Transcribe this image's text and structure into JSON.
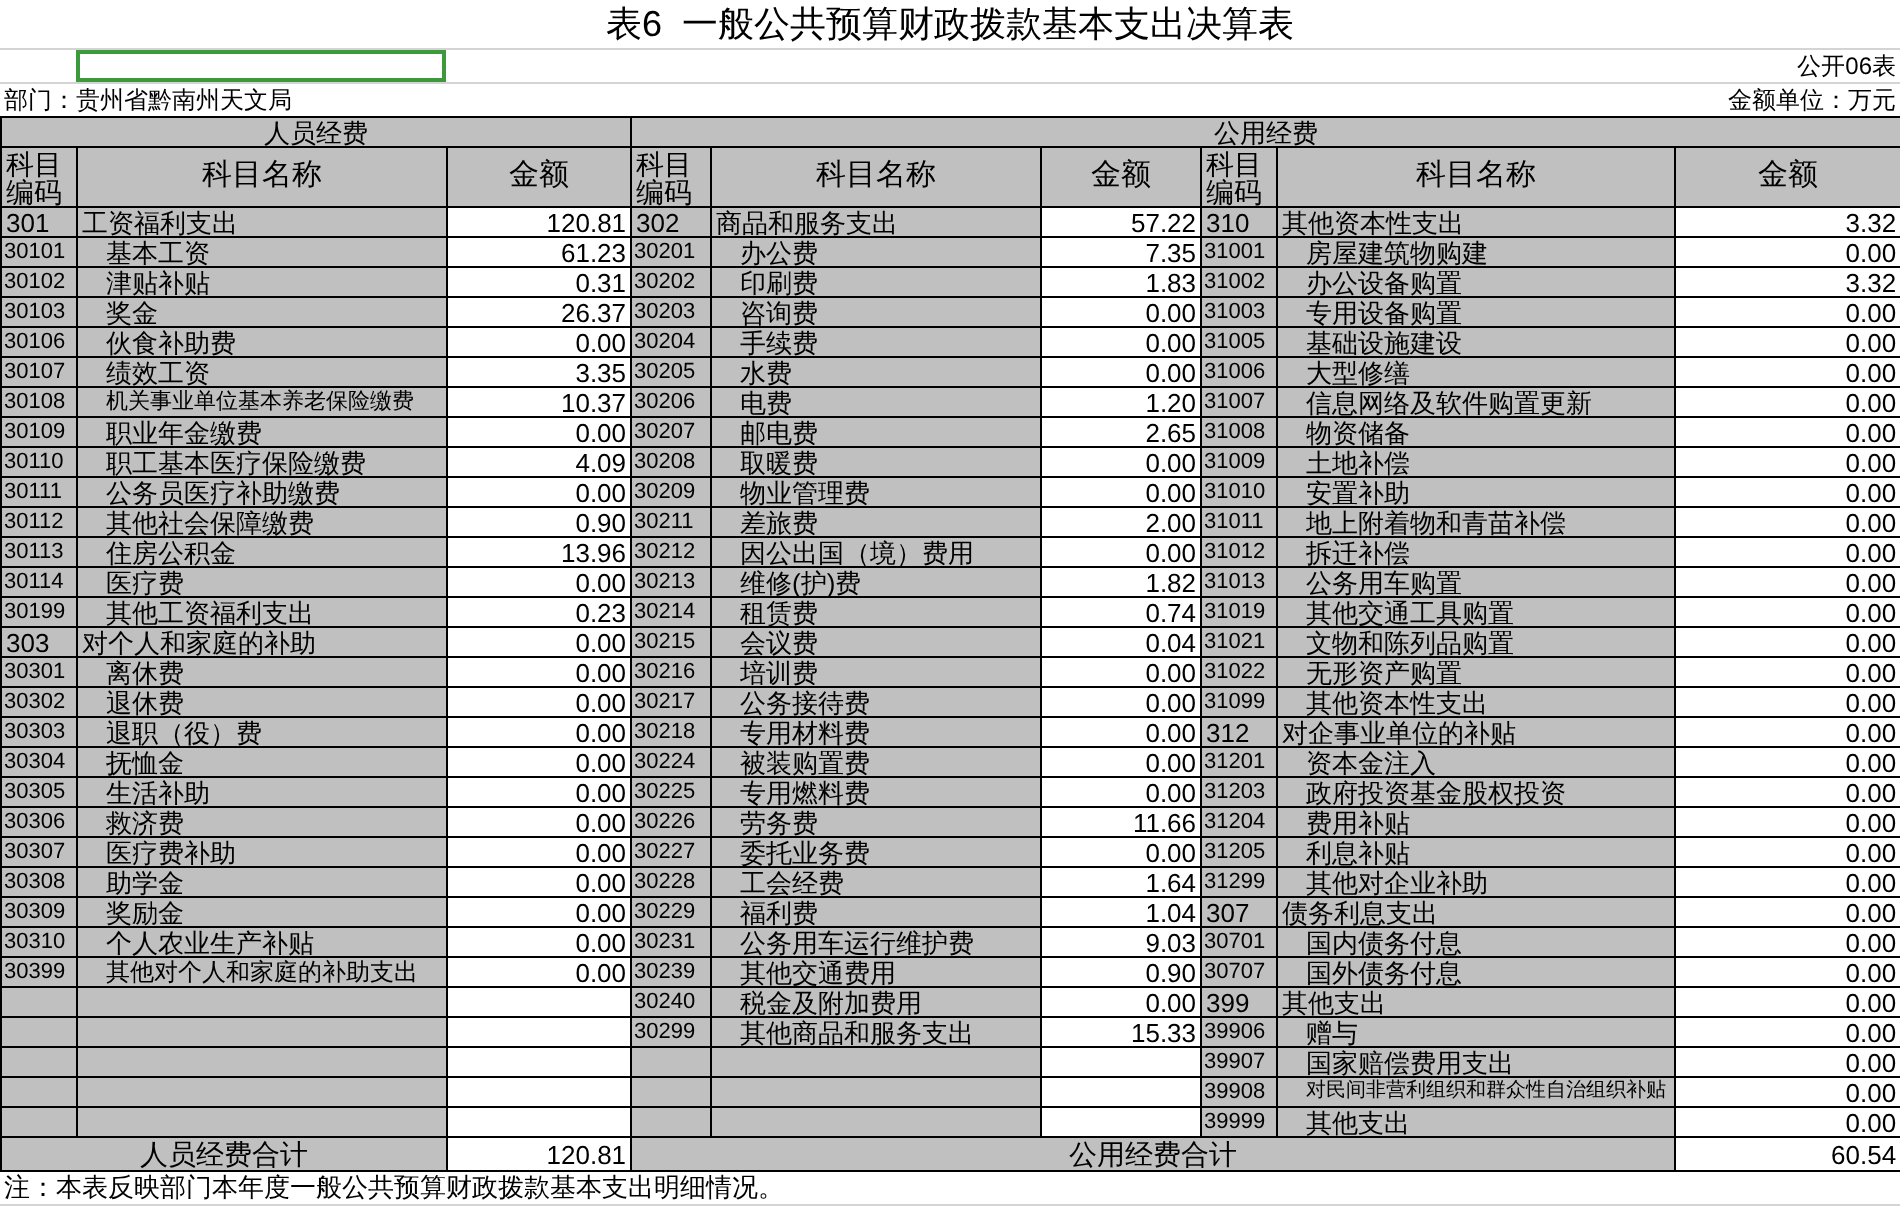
{
  "title": "表6  一般公共预算财政拨款基本支出决算表",
  "form_no": "公开06表",
  "department": "部门：贵州省黔南州天文局",
  "unit": "金额单位：万元",
  "sections": [
    {
      "title": "人员经费",
      "columns": [
        "科目编码",
        "科目名称",
        "金额"
      ],
      "rows": [
        {
          "kind": "category",
          "code": "301",
          "name": "工资福利支出",
          "amount": "120.81"
        },
        {
          "kind": "item",
          "code": "30101",
          "name": "基本工资",
          "amount": "61.23"
        },
        {
          "kind": "item",
          "code": "30102",
          "name": "津贴补贴",
          "amount": "0.31"
        },
        {
          "kind": "item",
          "code": "30103",
          "name": "奖金",
          "amount": "26.37"
        },
        {
          "kind": "item",
          "code": "30106",
          "name": "伙食补助费",
          "amount": "0.00"
        },
        {
          "kind": "item",
          "code": "30107",
          "name": "绩效工资",
          "amount": "3.35"
        },
        {
          "kind": "item",
          "code": "30108",
          "name": "机关事业单位基本养老保险缴费",
          "amount": "10.37"
        },
        {
          "kind": "item",
          "code": "30109",
          "name": "职业年金缴费",
          "amount": "0.00"
        },
        {
          "kind": "item",
          "code": "30110",
          "name": "职工基本医疗保险缴费",
          "amount": "4.09"
        },
        {
          "kind": "item",
          "code": "30111",
          "name": "公务员医疗补助缴费",
          "amount": "0.00"
        },
        {
          "kind": "item",
          "code": "30112",
          "name": "其他社会保障缴费",
          "amount": "0.90"
        },
        {
          "kind": "item",
          "code": "30113",
          "name": "住房公积金",
          "amount": "13.96"
        },
        {
          "kind": "item",
          "code": "30114",
          "name": "医疗费",
          "amount": "0.00"
        },
        {
          "kind": "item",
          "code": "30199",
          "name": "其他工资福利支出",
          "amount": "0.23"
        },
        {
          "kind": "category",
          "code": "303",
          "name": "对个人和家庭的补助",
          "amount": "0.00"
        },
        {
          "kind": "item",
          "code": "30301",
          "name": "离休费",
          "amount": "0.00"
        },
        {
          "kind": "item",
          "code": "30302",
          "name": "退休费",
          "amount": "0.00"
        },
        {
          "kind": "item",
          "code": "30303",
          "name": "退职（役）费",
          "amount": "0.00"
        },
        {
          "kind": "item",
          "code": "30304",
          "name": "抚恤金",
          "amount": "0.00"
        },
        {
          "kind": "item",
          "code": "30305",
          "name": "生活补助",
          "amount": "0.00"
        },
        {
          "kind": "item",
          "code": "30306",
          "name": "救济费",
          "amount": "0.00"
        },
        {
          "kind": "item",
          "code": "30307",
          "name": "医疗费补助",
          "amount": "0.00"
        },
        {
          "kind": "item",
          "code": "30308",
          "name": "助学金",
          "amount": "0.00"
        },
        {
          "kind": "item",
          "code": "30309",
          "name": "奖励金",
          "amount": "0.00"
        },
        {
          "kind": "item",
          "code": "30310",
          "name": "个人农业生产补贴",
          "amount": "0.00"
        },
        {
          "kind": "item",
          "code": "30399",
          "name": "其他对个人和家庭的补助支出",
          "amount": "0.00"
        }
      ]
    },
    {
      "title": "公用经费",
      "columns": [
        "科目编码",
        "科目名称",
        "金额"
      ],
      "rows": [
        {
          "kind": "category",
          "code": "302",
          "name": "商品和服务支出",
          "amount": "57.22"
        },
        {
          "kind": "item",
          "code": "30201",
          "name": "办公费",
          "amount": "7.35"
        },
        {
          "kind": "item",
          "code": "30202",
          "name": "印刷费",
          "amount": "1.83"
        },
        {
          "kind": "item",
          "code": "30203",
          "name": "咨询费",
          "amount": "0.00"
        },
        {
          "kind": "item",
          "code": "30204",
          "name": "手续费",
          "amount": "0.00"
        },
        {
          "kind": "item",
          "code": "30205",
          "name": "水费",
          "amount": "0.00"
        },
        {
          "kind": "item",
          "code": "30206",
          "name": "电费",
          "amount": "1.20"
        },
        {
          "kind": "item",
          "code": "30207",
          "name": "邮电费",
          "amount": "2.65"
        },
        {
          "kind": "item",
          "code": "30208",
          "name": "取暖费",
          "amount": "0.00"
        },
        {
          "kind": "item",
          "code": "30209",
          "name": "物业管理费",
          "amount": "0.00"
        },
        {
          "kind": "item",
          "code": "30211",
          "name": "差旅费",
          "amount": "2.00"
        },
        {
          "kind": "item",
          "code": "30212",
          "name": "因公出国（境）费用",
          "amount": "0.00"
        },
        {
          "kind": "item",
          "code": "30213",
          "name": "维修(护)费",
          "amount": "1.82"
        },
        {
          "kind": "item",
          "code": "30214",
          "name": "租赁费",
          "amount": "0.74"
        },
        {
          "kind": "item",
          "code": "30215",
          "name": "会议费",
          "amount": "0.04"
        },
        {
          "kind": "item",
          "code": "30216",
          "name": "培训费",
          "amount": "0.00"
        },
        {
          "kind": "item",
          "code": "30217",
          "name": "公务接待费",
          "amount": "0.00"
        },
        {
          "kind": "item",
          "code": "30218",
          "name": "专用材料费",
          "amount": "0.00"
        },
        {
          "kind": "item",
          "code": "30224",
          "name": "被装购置费",
          "amount": "0.00"
        },
        {
          "kind": "item",
          "code": "30225",
          "name": "专用燃料费",
          "amount": "0.00"
        },
        {
          "kind": "item",
          "code": "30226",
          "name": "劳务费",
          "amount": "11.66"
        },
        {
          "kind": "item",
          "code": "30227",
          "name": "委托业务费",
          "amount": "0.00"
        },
        {
          "kind": "item",
          "code": "30228",
          "name": "工会经费",
          "amount": "1.64"
        },
        {
          "kind": "item",
          "code": "30229",
          "name": "福利费",
          "amount": "1.04"
        },
        {
          "kind": "item",
          "code": "30231",
          "name": "公务用车运行维护费",
          "amount": "9.03"
        },
        {
          "kind": "item",
          "code": "30239",
          "name": "其他交通费用",
          "amount": "0.90"
        },
        {
          "kind": "item",
          "code": "30240",
          "name": "税金及附加费用",
          "amount": "0.00"
        },
        {
          "kind": "item",
          "code": "30299",
          "name": "其他商品和服务支出",
          "amount": "15.33"
        }
      ]
    },
    {
      "columns": [
        "科目编码",
        "科目名称",
        "金额"
      ],
      "rows": [
        {
          "kind": "category",
          "code": "310",
          "name": "其他资本性支出",
          "amount": "3.32"
        },
        {
          "kind": "item",
          "code": "31001",
          "name": "房屋建筑物购建",
          "amount": "0.00"
        },
        {
          "kind": "item",
          "code": "31002",
          "name": "办公设备购置",
          "amount": "3.32"
        },
        {
          "kind": "item",
          "code": "31003",
          "name": "专用设备购置",
          "amount": "0.00"
        },
        {
          "kind": "item",
          "code": "31005",
          "name": "基础设施建设",
          "amount": "0.00"
        },
        {
          "kind": "item",
          "code": "31006",
          "name": "大型修缮",
          "amount": "0.00"
        },
        {
          "kind": "item",
          "code": "31007",
          "name": "信息网络及软件购置更新",
          "amount": "0.00"
        },
        {
          "kind": "item",
          "code": "31008",
          "name": "物资储备",
          "amount": "0.00"
        },
        {
          "kind": "item",
          "code": "31009",
          "name": "土地补偿",
          "amount": "0.00"
        },
        {
          "kind": "item",
          "code": "31010",
          "name": "安置补助",
          "amount": "0.00"
        },
        {
          "kind": "item",
          "code": "31011",
          "name": "地上附着物和青苗补偿",
          "amount": "0.00"
        },
        {
          "kind": "item",
          "code": "31012",
          "name": "拆迁补偿",
          "amount": "0.00"
        },
        {
          "kind": "item",
          "code": "31013",
          "name": "公务用车购置",
          "amount": "0.00"
        },
        {
          "kind": "item",
          "code": "31019",
          "name": "其他交通工具购置",
          "amount": "0.00"
        },
        {
          "kind": "item",
          "code": "31021",
          "name": "文物和陈列品购置",
          "amount": "0.00"
        },
        {
          "kind": "item",
          "code": "31022",
          "name": "无形资产购置",
          "amount": "0.00"
        },
        {
          "kind": "item",
          "code": "31099",
          "name": "其他资本性支出",
          "amount": "0.00"
        },
        {
          "kind": "category",
          "code": "312",
          "name": "对企事业单位的补贴",
          "amount": "0.00"
        },
        {
          "kind": "item",
          "code": "31201",
          "name": "资本金注入",
          "amount": "0.00"
        },
        {
          "kind": "item",
          "code": "31203",
          "name": "政府投资基金股权投资",
          "amount": "0.00"
        },
        {
          "kind": "item",
          "code": "31204",
          "name": "费用补贴",
          "amount": "0.00"
        },
        {
          "kind": "item",
          "code": "31205",
          "name": "利息补贴",
          "amount": "0.00"
        },
        {
          "kind": "item",
          "code": "31299",
          "name": "其他对企业补助",
          "amount": "0.00"
        },
        {
          "kind": "category",
          "code": "307",
          "name": "债务利息支出",
          "amount": "0.00"
        },
        {
          "kind": "item",
          "code": "30701",
          "name": "国内债务付息",
          "amount": "0.00"
        },
        {
          "kind": "item",
          "code": "30707",
          "name": "国外债务付息",
          "amount": "0.00"
        },
        {
          "kind": "category",
          "code": "399",
          "name": "其他支出",
          "amount": "0.00"
        },
        {
          "kind": "item",
          "code": "39906",
          "name": "赠与",
          "amount": "0.00"
        },
        {
          "kind": "item",
          "code": "39907",
          "name": "国家赔偿费用支出",
          "amount": "0.00"
        },
        {
          "kind": "item",
          "code": "39908",
          "name": "对民间非营利组织和群众性自治组织补贴",
          "amount": "0.00"
        },
        {
          "kind": "item",
          "code": "39999",
          "name": "其他支出",
          "amount": "0.00"
        }
      ]
    }
  ],
  "totals": [
    {
      "label": "人员经费合计",
      "amount": "120.81"
    },
    {
      "label": "公用经费合计",
      "amount": "60.54"
    }
  ],
  "note": "注：本表反映部门本年度一般公共预算财政拨款基本支出明细情况。"
}
